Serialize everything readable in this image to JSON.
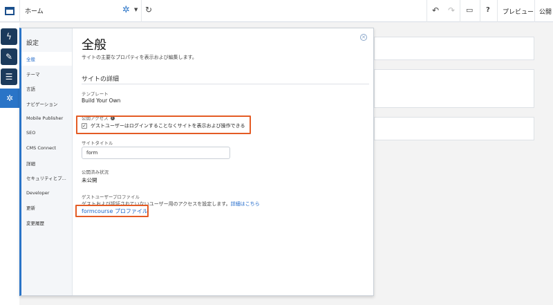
{
  "topbar": {
    "page_name": "ホーム",
    "preview_label": "プレビュー",
    "publish_label": "公開"
  },
  "panel": {
    "nav_title": "設定",
    "nav_items": [
      "全般",
      "テーマ",
      "言語",
      "ナビゲーション",
      "Mobile Publisher",
      "SEO",
      "CMS Connect",
      "詳細",
      "セキュリティとプ...",
      "Developer",
      "更新",
      "変更履歴"
    ],
    "title": "全般",
    "subtitle": "サイトの主要なプロパティを表示および編集します。",
    "section_title": "サイトの詳細",
    "template_label": "テンプレート",
    "template_value": "Build Your Own",
    "public_access_label": "公開アクセス",
    "guest_checkbox_label": "ゲストユーザーはログインすることなくサイトを表示および操作できる",
    "guest_checkbox_checked": true,
    "site_title_label": "サイトタイトル",
    "site_title_value": "form",
    "publish_status_label": "公開済み状況",
    "publish_status_value": "未公開",
    "guest_profile_label": "ゲストユーザープロファイル",
    "guest_profile_desc": "ゲストおよび認証されていないユーザー用のアクセスを設定します。",
    "details_link": "詳細はこちら",
    "profile_link": "formcourse プロファイル"
  },
  "colors": {
    "accent": "#2a74c7",
    "highlight": "#e45b24",
    "rail_dark": "#1b3a5c"
  }
}
